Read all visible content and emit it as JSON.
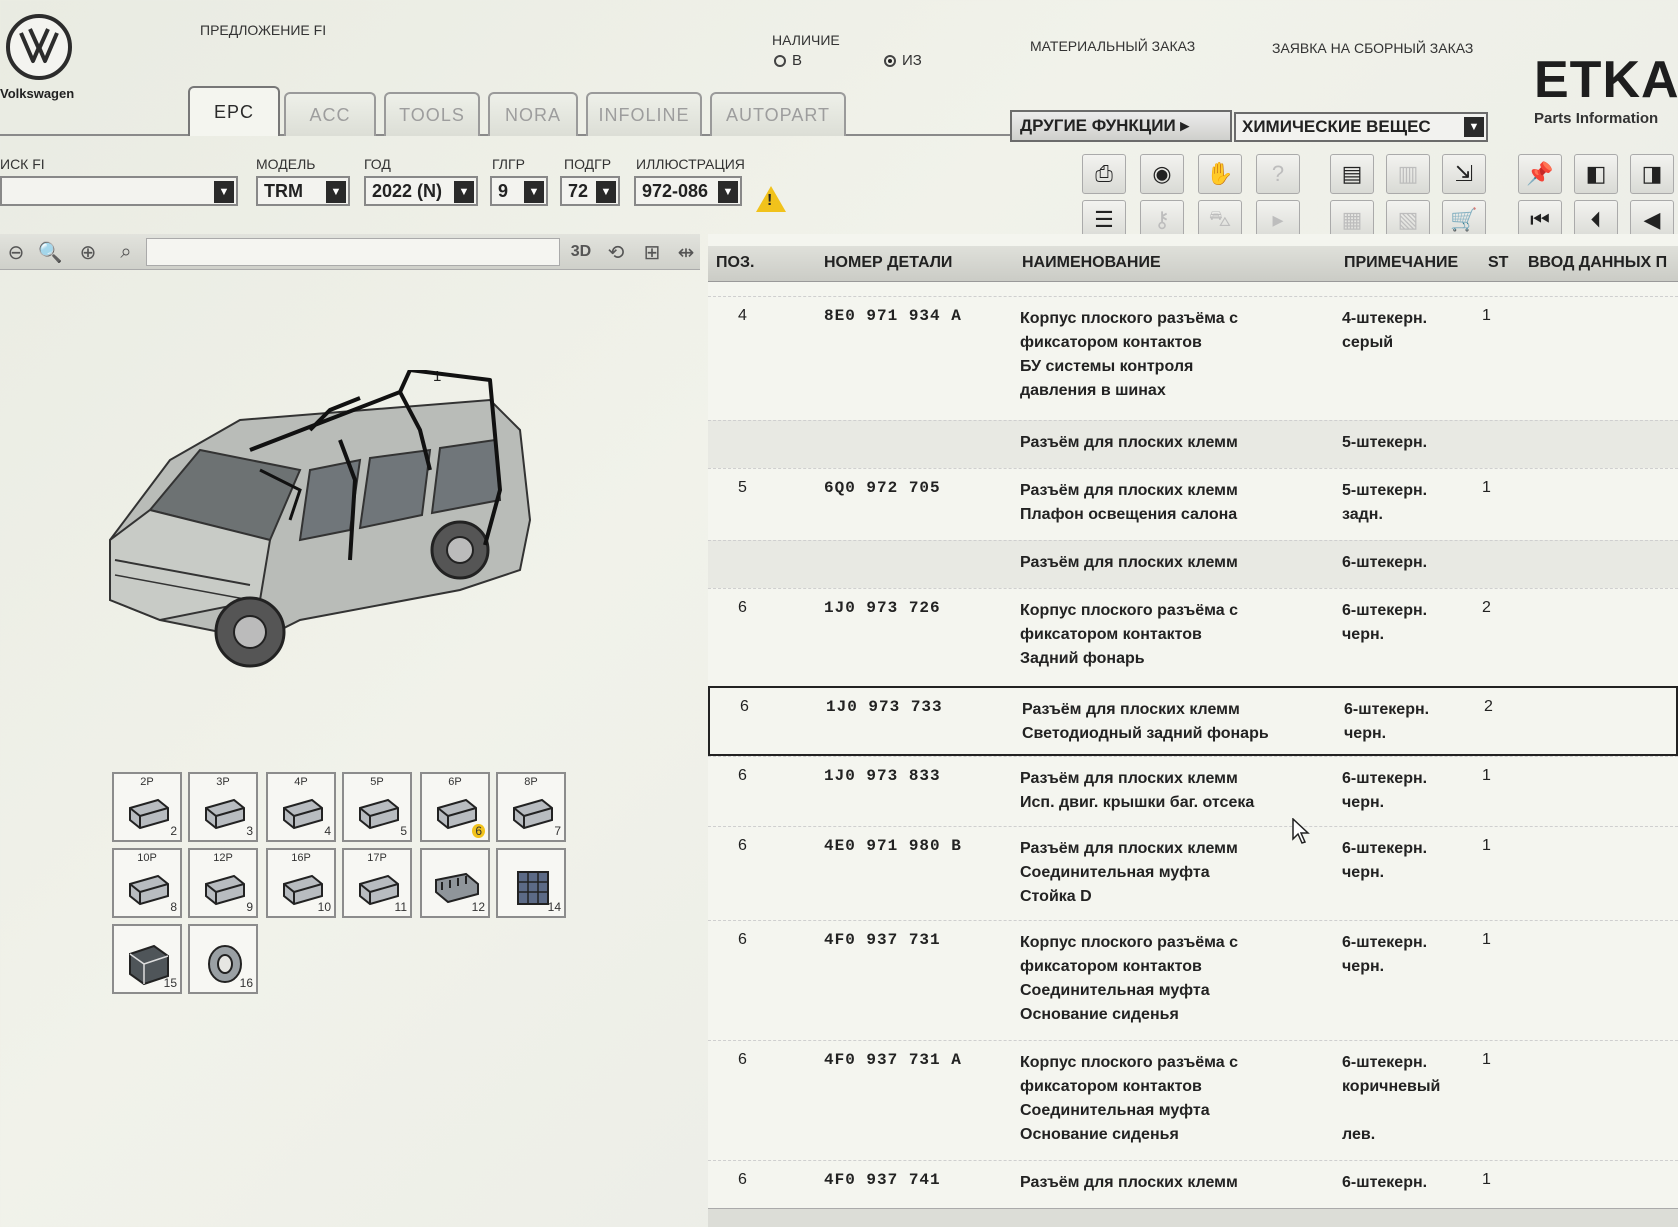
{
  "header": {
    "brand": "Volkswagen",
    "offer_label": "ПРЕДЛОЖЕНИЕ FI",
    "availability_label": "НАЛИЧИЕ",
    "radio_in": "В",
    "radio_from": "ИЗ",
    "material_order": "МАТЕРИАЛЬНЫЙ ЗАКАЗ",
    "assembly_order": "ЗАЯВКА НА СБОРНЫЙ ЗАКАЗ",
    "etka_logo": "ETKA",
    "etka_sub": "Parts Information"
  },
  "tabs": [
    "EPC",
    "ACC",
    "TOOLS",
    "NORA",
    "INFOLINE",
    "AUTOPART"
  ],
  "other_functions": "ДРУГИЕ ФУНКЦИИ ▸",
  "chem_select": "ХИМИЧЕСКИЕ ВЕЩЕС",
  "filters": {
    "search_label": "ИСК FI",
    "model_label": "МОДЕЛЬ",
    "model_value": "TRM",
    "year_label": "ГОД",
    "year_value": "2022 (N)",
    "main_group_label": "ГЛГР",
    "main_group_value": "9",
    "sub_group_label": "ПОДГР",
    "sub_group_value": "72",
    "illustration_label": "ИЛЛЮСТРАЦИЯ",
    "illustration_value": "972-086"
  },
  "viewer": {
    "btn_3d": "3D",
    "car_position_label": "1",
    "thumbnails": [
      {
        "label": "2P",
        "num": "2"
      },
      {
        "label": "3P",
        "num": "3"
      },
      {
        "label": "4P",
        "num": "4"
      },
      {
        "label": "5P",
        "num": "5"
      },
      {
        "label": "6P",
        "num": "6"
      },
      {
        "label": "8P",
        "num": "7"
      },
      {
        "label": "10P",
        "num": "8"
      },
      {
        "label": "12P",
        "num": "9"
      },
      {
        "label": "16P",
        "num": "10"
      },
      {
        "label": "17P",
        "num": "11"
      },
      {
        "label": "",
        "num": "12"
      },
      {
        "label": "",
        "num": "14"
      },
      {
        "label": "",
        "num": "15"
      },
      {
        "label": "",
        "num": "16"
      }
    ]
  },
  "table": {
    "headers": {
      "pos": "ПОЗ.",
      "part": "НОМЕР ДЕТАЛИ",
      "name": "НАИМЕНОВАНИЕ",
      "note": "ПРИМЕЧАНИЕ",
      "st": "ST",
      "entry": "ВВОД ДАННЫХ П"
    },
    "rows": [
      {
        "pos": "4",
        "part": "8E0 971 934 A",
        "name": [
          "Корпус плоского разъёма с",
          "фиксатором контактов",
          "БУ системы контроля",
          "давления в шинах"
        ],
        "note": [
          "4-штекерн.",
          "серый"
        ],
        "st": "1"
      },
      {
        "pos": "",
        "part": "",
        "name": [
          "Разъём для плоских клемм"
        ],
        "note": [
          "5-штекерн."
        ],
        "st": ""
      },
      {
        "pos": "5",
        "part": "6Q0 972 705",
        "name": [
          "Разъём для плоских клемм",
          "Плафон освещения салона"
        ],
        "note": [
          "5-штекерн.",
          "задн."
        ],
        "st": "1"
      },
      {
        "pos": "",
        "part": "",
        "name": [
          "Разъём для плоских клемм"
        ],
        "note": [
          "6-штекерн."
        ],
        "st": ""
      },
      {
        "pos": "6",
        "part": "1J0 973 726",
        "name": [
          "Корпус плоского разъёма с",
          "фиксатором контактов",
          "Задний фонарь"
        ],
        "note": [
          "6-штекерн.",
          "черн."
        ],
        "st": "2"
      },
      {
        "pos": "6",
        "part": "1J0 973 733",
        "name": [
          "Разъём для плоских клемм",
          "Светодиодный задний фонарь"
        ],
        "note": [
          "6-штекерн.",
          "черн."
        ],
        "st": "2"
      },
      {
        "pos": "6",
        "part": "1J0 973 833",
        "name": [
          "Разъём для плоских клемм",
          "Исп. двиг. крышки баг. отсека"
        ],
        "note": [
          "6-штекерн.",
          "черн."
        ],
        "st": "1"
      },
      {
        "pos": "6",
        "part": "4E0 971 980 B",
        "name": [
          "Разъём для плоских клемм",
          "Соединительная муфта",
          "Стойка D"
        ],
        "note": [
          "6-штекерн.",
          "черн."
        ],
        "st": "1"
      },
      {
        "pos": "6",
        "part": "4F0 937 731",
        "name": [
          "Корпус плоского разъёма с",
          "фиксатором контактов",
          "Соединительная муфта",
          "Основание сиденья"
        ],
        "note": [
          "6-штекерн.",
          "черн."
        ],
        "st": "1"
      },
      {
        "pos": "6",
        "part": "4F0 937 731 A",
        "name": [
          "Корпус плоского разъёма с",
          "фиксатором контактов",
          "Соединительная муфта",
          "Основание сиденья"
        ],
        "note": [
          "6-штекерн.",
          "коричневый",
          "",
          "лев."
        ],
        "st": "1"
      },
      {
        "pos": "6",
        "part": "4F0 937 741",
        "name": [
          "Разъём для плоских клемм"
        ],
        "note": [
          "6-штекерн."
        ],
        "st": "1"
      }
    ]
  },
  "colors": {
    "warning": "#f1c21b",
    "background": "#f4f5ef"
  }
}
